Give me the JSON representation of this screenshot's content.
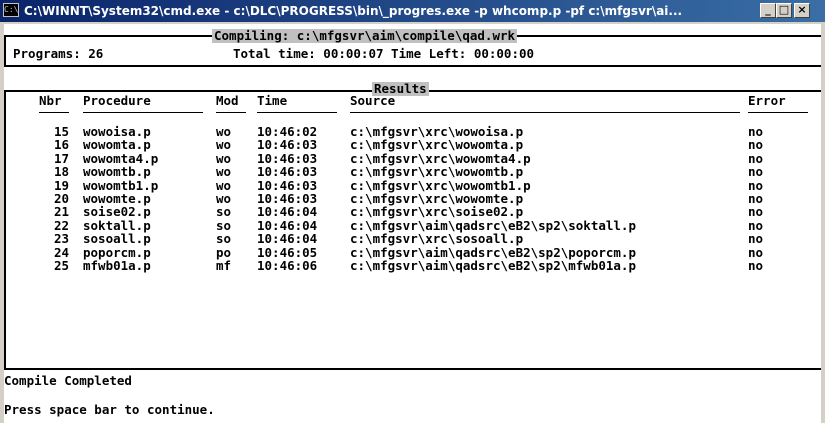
{
  "window": {
    "icon_text": "C:\\",
    "title": "C:\\WINNT\\System32\\cmd.exe - c:\\DLC\\PROGRESS\\bin\\_progres.exe -p whcomp.p -pf c:\\mfgsvr\\ai...",
    "buttons": {
      "minimize": "_",
      "maximize": "□",
      "close": "×"
    },
    "icons": [
      "console-icon",
      "minimize-icon",
      "maximize-icon",
      "close-icon"
    ]
  },
  "compile": {
    "compiling_label": "Compiling: c:\\mfgsvr\\aim\\compile\\qad.wrk",
    "programs": "Programs: 26",
    "time_line": "Total time: 00:00:07 Time Left: 00:00:00"
  },
  "results": {
    "title": "Results",
    "headers": {
      "nbr": "Nbr",
      "procedure": "Procedure",
      "mod": "Mod",
      "time": "Time",
      "source": "Source",
      "error": "Error"
    },
    "rows": [
      {
        "nbr": "15",
        "procedure": "wowoisa.p",
        "mod": "wo",
        "time": "10:46:02",
        "source": "c:\\mfgsvr\\xrc\\wowoisa.p",
        "error": "no"
      },
      {
        "nbr": "16",
        "procedure": "wowomta.p",
        "mod": "wo",
        "time": "10:46:03",
        "source": "c:\\mfgsvr\\xrc\\wowomta.p",
        "error": "no"
      },
      {
        "nbr": "17",
        "procedure": "wowomta4.p",
        "mod": "wo",
        "time": "10:46:03",
        "source": "c:\\mfgsvr\\xrc\\wowomta4.p",
        "error": "no"
      },
      {
        "nbr": "18",
        "procedure": "wowomtb.p",
        "mod": "wo",
        "time": "10:46:03",
        "source": "c:\\mfgsvr\\xrc\\wowomtb.p",
        "error": "no"
      },
      {
        "nbr": "19",
        "procedure": "wowomtb1.p",
        "mod": "wo",
        "time": "10:46:03",
        "source": "c:\\mfgsvr\\xrc\\wowomtb1.p",
        "error": "no"
      },
      {
        "nbr": "20",
        "procedure": "wowomte.p",
        "mod": "wo",
        "time": "10:46:03",
        "source": "c:\\mfgsvr\\xrc\\wowomte.p",
        "error": "no"
      },
      {
        "nbr": "21",
        "procedure": "soise02.p",
        "mod": "so",
        "time": "10:46:04",
        "source": "c:\\mfgsvr\\xrc\\soise02.p",
        "error": "no"
      },
      {
        "nbr": "22",
        "procedure": "soktall.p",
        "mod": "so",
        "time": "10:46:04",
        "source": "c:\\mfgsvr\\aim\\qadsrc\\eB2\\sp2\\soktall.p",
        "error": "no"
      },
      {
        "nbr": "23",
        "procedure": "sosoall.p",
        "mod": "so",
        "time": "10:46:04",
        "source": "c:\\mfgsvr\\xrc\\sosoall.p",
        "error": "no"
      },
      {
        "nbr": "24",
        "procedure": "poporcm.p",
        "mod": "po",
        "time": "10:46:05",
        "source": "c:\\mfgsvr\\aim\\qadsrc\\eB2\\sp2\\poporcm.p",
        "error": "no"
      },
      {
        "nbr": "25",
        "procedure": "mfwb01a.p",
        "mod": "mf",
        "time": "10:46:06",
        "source": "c:\\mfgsvr\\aim\\qadsrc\\eB2\\sp2\\mfwb01a.p",
        "error": "no"
      }
    ]
  },
  "status": {
    "completed": "Compile Completed",
    "prompt": "Press space bar to continue."
  }
}
